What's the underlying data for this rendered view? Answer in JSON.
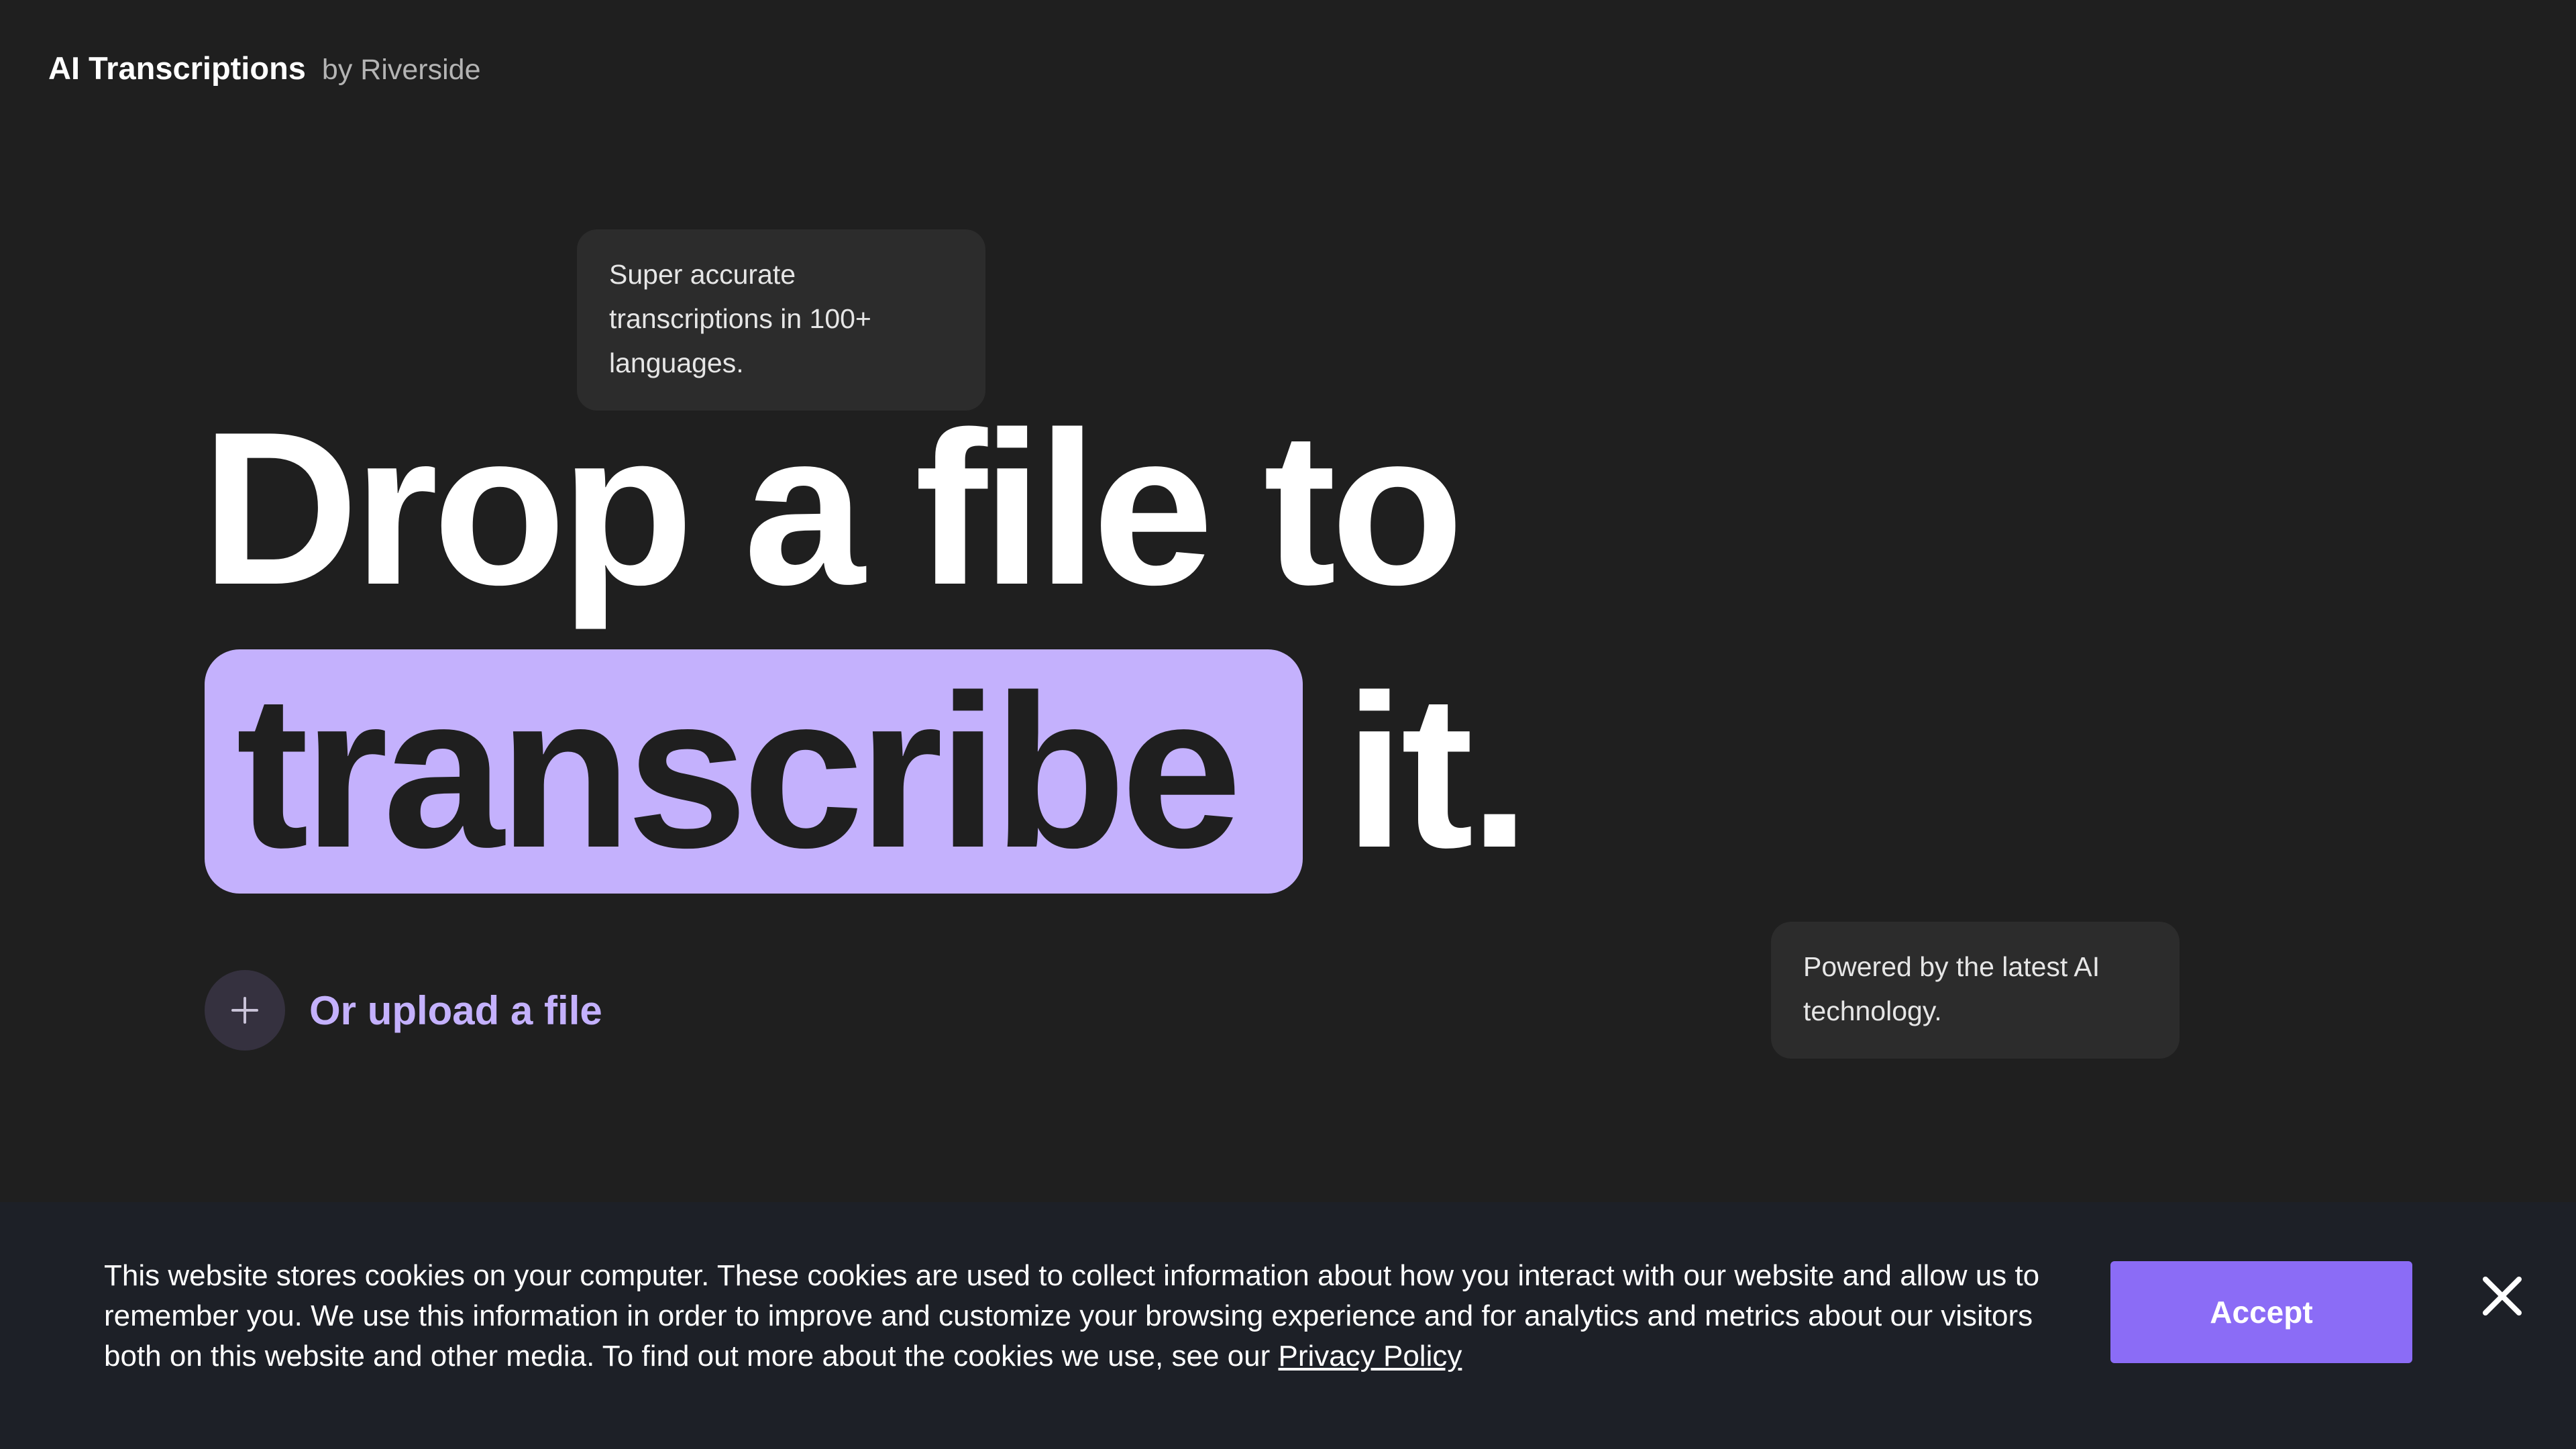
{
  "header": {
    "title": "AI Transcriptions",
    "byline": "by Riverside"
  },
  "tooltips": {
    "accuracy": "Super accurate transcriptions in 100+ languages.",
    "technology": "Powered by the latest AI technology."
  },
  "hero": {
    "line1": "Drop a file to",
    "highlight_word": "transcribe",
    "line2_suffix": "it."
  },
  "upload": {
    "label": "Or upload a file",
    "icon": "plus-icon"
  },
  "cookie_banner": {
    "text": "This website stores cookies on your computer. These cookies are used to collect information about how you interact with our website and allow us to remember you. We use this information in order to improve and customize your browsing experience and for analytics and metrics about our visitors both on this website and other media. To find out more about the cookies we use, see our",
    "link_label": "Privacy Policy",
    "accept_label": "Accept",
    "close_icon": "close-icon"
  },
  "colors": {
    "background": "#1f1f1f",
    "accent": "#c4b1fd",
    "button": "#8b6cf6",
    "cookie_bar": "#1d2027"
  }
}
